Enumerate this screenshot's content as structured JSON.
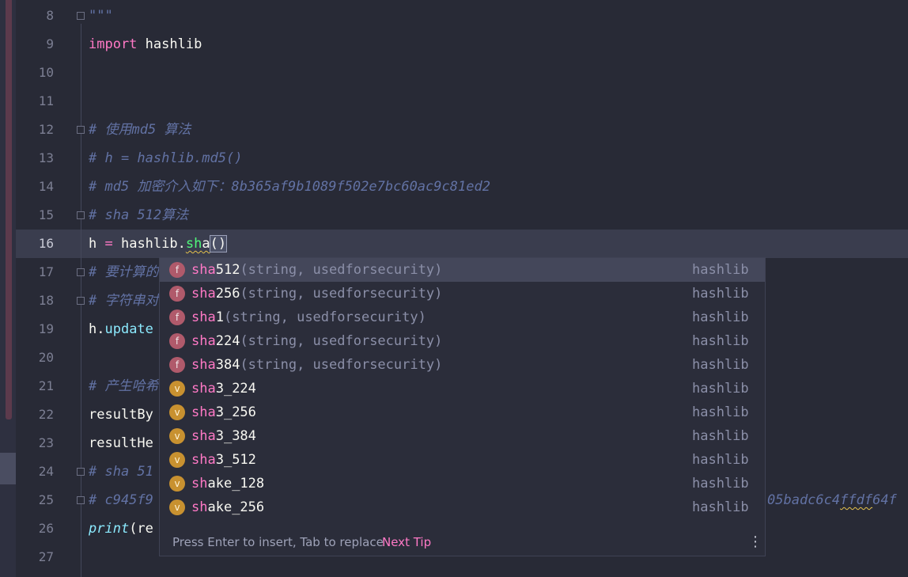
{
  "editor": {
    "line_numbers": [
      "8",
      "9",
      "10",
      "11",
      "12",
      "13",
      "14",
      "15",
      "16",
      "17",
      "18",
      "19",
      "20",
      "21",
      "22",
      "23",
      "24",
      "25",
      "26",
      "27"
    ],
    "current_line": "16",
    "lines": {
      "l8": "\"\"\"",
      "l9_kw": "import",
      "l9_rest": " hashlib",
      "l12": "# 使用md5 算法",
      "l13": "# h = hashlib.md5()",
      "l14": "# md5 加密介入如下：8b365af9b1089f502e7bc60ac9c81ed2",
      "l15": "# sha 512算法",
      "l16_a": "h ",
      "l16_eq": "=",
      "l16_b": " hashlib.",
      "l16_sh": "sh",
      "l16_a2": "a",
      "l16_paren": "()",
      "l17": "# 要计算的",
      "l18": "# 字符串对",
      "l19_a": "h.",
      "l19_fn": "update",
      "l21": "# 产生哈希",
      "l22": "resultBy",
      "l23": "resultHe",
      "l24": "# sha 51",
      "l25": "# c945f9",
      "l26_fn": "print",
      "l26_rest": "(re",
      "l25_tail_a": "05badc6c4",
      "l25_tail_b": "ffdf",
      "l25_tail_c": "64f"
    }
  },
  "completion": {
    "typed_prefix_note": "sha",
    "items": [
      {
        "kind": "f",
        "match": "sha",
        "rest": "512",
        "params": "(string, usedforsecurity)",
        "type": "hashlib",
        "selected": true
      },
      {
        "kind": "f",
        "match": "sha",
        "rest": "256",
        "params": "(string, usedforsecurity)",
        "type": "hashlib"
      },
      {
        "kind": "f",
        "match": "sha",
        "rest": "1",
        "params": "(string, usedforsecurity)",
        "type": "hashlib"
      },
      {
        "kind": "f",
        "match": "sha",
        "rest": "224",
        "params": "(string, usedforsecurity)",
        "type": "hashlib"
      },
      {
        "kind": "f",
        "match": "sha",
        "rest": "384",
        "params": "(string, usedforsecurity)",
        "type": "hashlib"
      },
      {
        "kind": "v",
        "match": "sha",
        "rest": "3_224",
        "params": "",
        "type": "hashlib"
      },
      {
        "kind": "v",
        "match": "sha",
        "rest": "3_256",
        "params": "",
        "type": "hashlib"
      },
      {
        "kind": "v",
        "match": "sha",
        "rest": "3_384",
        "params": "",
        "type": "hashlib"
      },
      {
        "kind": "v",
        "match": "sha",
        "rest": "3_512",
        "params": "",
        "type": "hashlib"
      },
      {
        "kind": "v",
        "match": "sh",
        "rest": "ake_128",
        "params": "",
        "type": "hashlib"
      },
      {
        "kind": "v",
        "match": "sh",
        "rest": "ake_256",
        "params": "",
        "type": "hashlib"
      }
    ],
    "footer_hint": "Press Enter to insert, Tab to replace",
    "footer_tip": "Next Tip",
    "footer_menu_icon": "more-vertical-icon",
    "badge_colors": {
      "f": "#b05a6b",
      "v": "#c89130"
    }
  },
  "theme": {
    "background": "#282a36",
    "keyword": "#ff79c6",
    "function": "#50fa7b",
    "comment": "#6272a4"
  }
}
